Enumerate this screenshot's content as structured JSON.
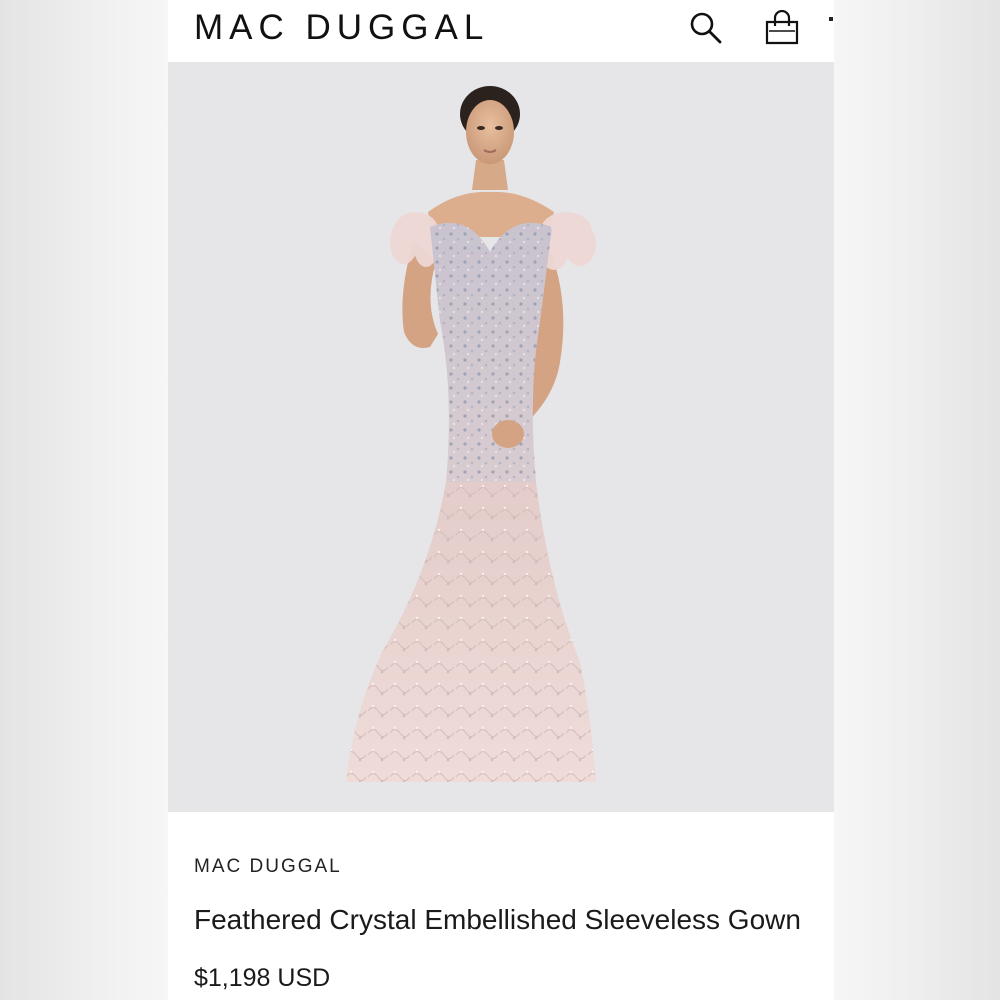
{
  "header": {
    "brand": "MAC DUGGAL",
    "search_icon": "search-icon",
    "bag_icon": "shopping-bag-icon",
    "menu_icon": "more-icon"
  },
  "hero": {
    "image_subject": "model-wearing-gown",
    "background_color": "#e6e6e8"
  },
  "product": {
    "brand": "MAC DUGGAL",
    "title": "Feathered Crystal Embellished Sleeveless Gown",
    "price": "$1,198 USD"
  },
  "colors": {
    "text": "#1a1a1a",
    "gown_blush": "#e9d4d0",
    "gown_beading": "#9aa0b4"
  }
}
